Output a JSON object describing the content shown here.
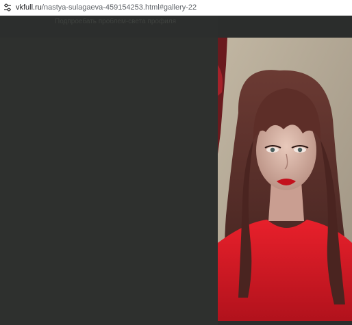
{
  "browser": {
    "url_host": "vkfull.ru",
    "url_path": "/nastya-sulagaeva-459154253.html#gallery-22",
    "site_icon": "tune-icon"
  },
  "page": {
    "faded_text": "Подпроебать проблем-света профиля"
  },
  "gallery": {
    "photo_subject": "portrait-photo",
    "colors": {
      "background": "#2c2e2d",
      "shirt": "#e01b26",
      "hair": "#5a2a26",
      "wall": "#b7ab97"
    }
  }
}
